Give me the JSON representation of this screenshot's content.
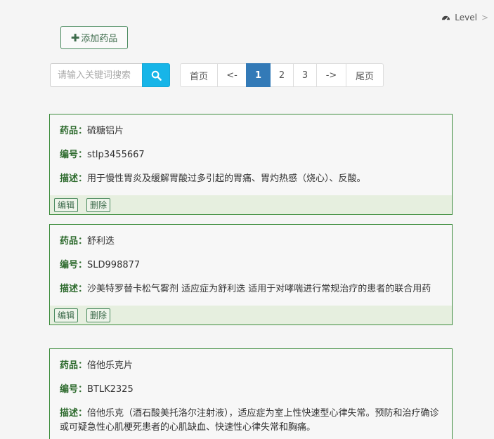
{
  "breadcrumb": {
    "icon": "dashboard-gauge-icon",
    "label": "Level",
    "separator": ">"
  },
  "toolbar": {
    "add_label": "添加药品",
    "add_icon": "plus-icon"
  },
  "search": {
    "placeholder": "请输入关键词搜索",
    "icon": "search-icon"
  },
  "pager": [
    "首页",
    "<-",
    "1",
    "2",
    "3",
    "->",
    "尾页"
  ],
  "pager_active": "1",
  "labels": {
    "drug": "药品：",
    "code": "编号：",
    "desc": "描述：",
    "edit": "编辑",
    "delete": "删除"
  },
  "drugs": [
    {
      "name": "硫糖铝片",
      "code": "stlp3455667",
      "desc": "用于慢性胃炎及缓解胃酸过多引起的胃痛、胃灼热感（烧心）、反酸。"
    },
    {
      "name": "舒利迭",
      "code": "SLD998877",
      "desc": "沙美特罗替卡松气雾剂 适应症为舒利迭 适用于对哮喘进行常规治疗的患者的联合用药"
    },
    {
      "name": "倍他乐克片",
      "code": "BTLK2325",
      "desc": "倍他乐克（酒石酸美托洛尔注射液），适应症为室上性快速型心律失常。预防和治疗确诊或可疑急性心肌梗死患者的心肌缺血、快速性心律失常和胸痛。"
    }
  ],
  "colors": {
    "accent": "#17b5e8",
    "active_page": "#337ab7",
    "card_border": "#3c8c3c",
    "label_green": "#2e6b2e"
  }
}
